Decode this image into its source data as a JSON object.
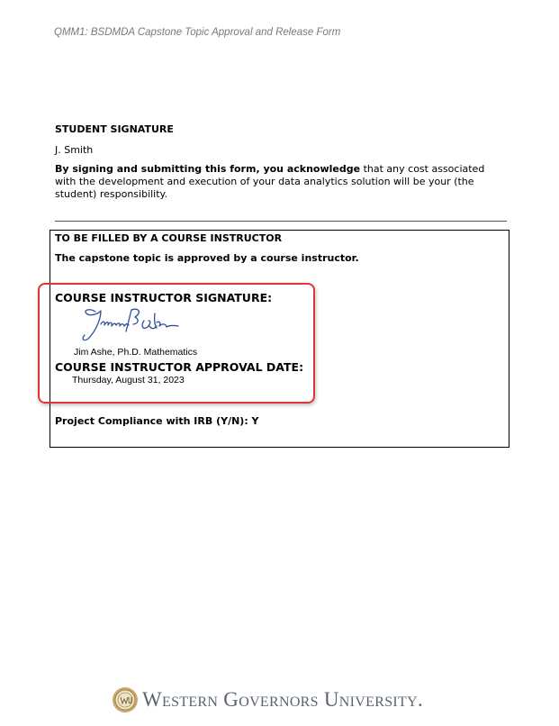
{
  "header": {
    "title": "QMM1: BSDMDA Capstone Topic Approval and Release Form"
  },
  "student_section": {
    "title": "STUDENT SIGNATURE",
    "name": "J. Smith",
    "ack_bold": "By signing and submitting this form, you acknowledge",
    "ack_rest": " that any cost associated with the development and execution of your data analytics solution will be your (the student) responsibility."
  },
  "instructor_section": {
    "title": "TO BE FILLED BY A COURSE INSTRUCTOR",
    "approval_statement": "The capstone topic is approved by a course instructor.",
    "signature_label": "COURSE INSTRUCTOR SIGNATURE:",
    "signer_name": "Jim Ashe, Ph.D. Mathematics",
    "date_label": "COURSE INSTRUCTOR APPROVAL DATE:",
    "approval_date": "Thursday, August 31, 2023",
    "irb_compliance": "Project Compliance with IRB (Y/N): Y"
  },
  "footer": {
    "university": "Western Governors University."
  },
  "colors": {
    "highlight": "#e0333a",
    "signature_ink": "#2a4f9a",
    "footer_text": "#5a6470"
  },
  "icons": [
    "handwritten-signature",
    "wgu-seal-logo"
  ]
}
